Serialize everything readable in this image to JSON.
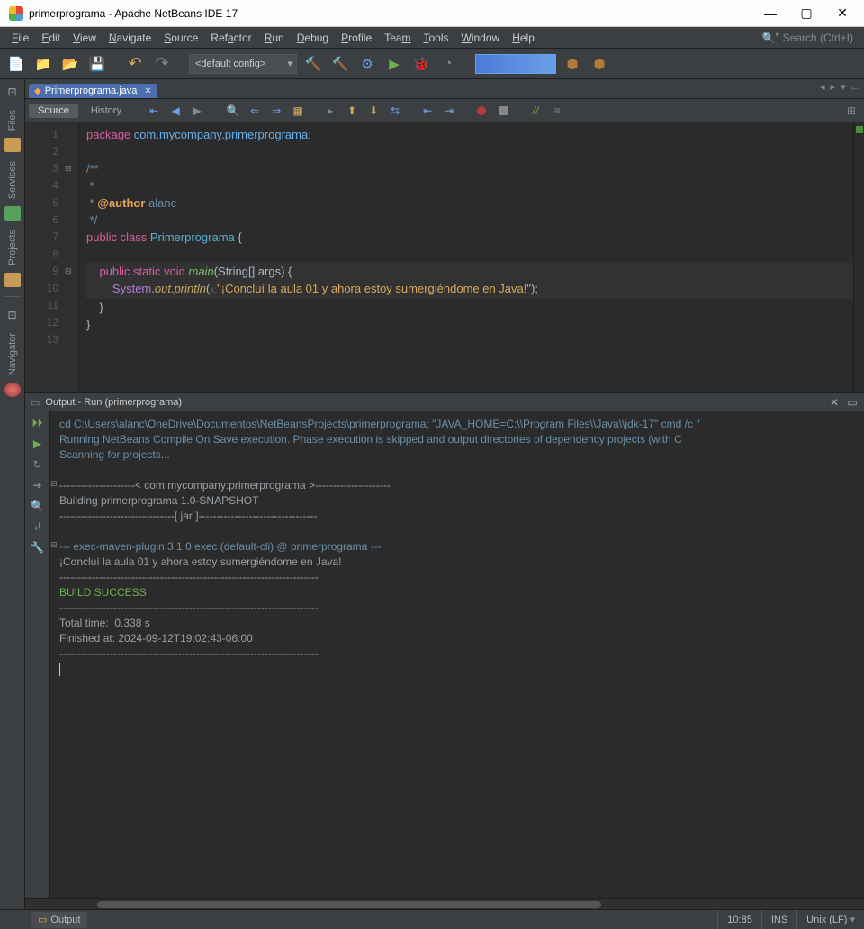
{
  "window": {
    "title": "primerprograma - Apache NetBeans IDE 17"
  },
  "menu": {
    "items": [
      "File",
      "Edit",
      "View",
      "Navigate",
      "Source",
      "Refactor",
      "Run",
      "Debug",
      "Profile",
      "Team",
      "Tools",
      "Window",
      "Help"
    ],
    "search_placeholder": "Search (Ctrl+I)"
  },
  "toolbar": {
    "config": "<default config>"
  },
  "tabs": {
    "active_file": "Primerprograma.java"
  },
  "editor_tabs": {
    "source": "Source",
    "history": "History"
  },
  "code": {
    "lines": [
      "1",
      "2",
      "3",
      "4",
      "5",
      "6",
      "7",
      "8",
      "9",
      "10",
      "11",
      "12",
      "13"
    ],
    "l1_package": "package",
    "l1_pkg_a": "com",
    "l1_pkg_b": "mycompany",
    "l1_pkg_c": "primerprograma",
    "l3": "/**",
    "l4": " *",
    "l5_pre": " * ",
    "l5_tag": "@author",
    "l5_name": " alanc",
    "l6": " */",
    "l7_public": "public",
    "l7_class": "class",
    "l7_name": "Primerprograma",
    "l7_brace": " {",
    "l9_public": "public",
    "l9_static": "static",
    "l9_void": "void",
    "l9_main": "main",
    "l9_params": "(String[] args) {",
    "l10_sys": "System",
    "l10_out": "out",
    "l10_println": "println",
    "l10_open": "(",
    "l10_x": "x:",
    "l10_str": "\"¡Concluí la aula 01 y ahora estoy sumergiéndome en Java!\"",
    "l10_close": ");",
    "l11": "    }",
    "l12": "}"
  },
  "output": {
    "title": "Output - Run (primerprograma)",
    "l1": "cd C:\\Users\\alanc\\OneDrive\\Documentos\\NetBeansProjects\\primerprograma; \"JAVA_HOME=C:\\\\Program Files\\\\Java\\\\jdk-17\" cmd /c \"",
    "l2": "Running NetBeans Compile On Save execution. Phase execution is skipped and output directories of dependency projects (with C",
    "l3": "Scanning for projects...",
    "l5": "---------------------< com.mycompany:primerprograma >---------------------",
    "l6": "Building primerprograma 1.0-SNAPSHOT",
    "l7": "--------------------------------[ jar ]---------------------------------",
    "l9": "--- exec-maven-plugin:3.1.0:exec (default-cli) @ primerprograma ---",
    "l10": "¡Concluí la aula 01 y ahora estoy sumergiéndome en Java!",
    "sep": "------------------------------------------------------------------------",
    "build": "BUILD SUCCESS",
    "time": "Total time:  0.338 s",
    "finished": "Finished at: 2024-09-12T19:02:43-06:00"
  },
  "status": {
    "output_btn": "Output",
    "pos": "10:85",
    "ins": "INS",
    "eol": "Unix (LF)"
  },
  "sidebar": {
    "files": "Files",
    "services": "Services",
    "projects": "Projects",
    "navigator": "Navigator"
  }
}
